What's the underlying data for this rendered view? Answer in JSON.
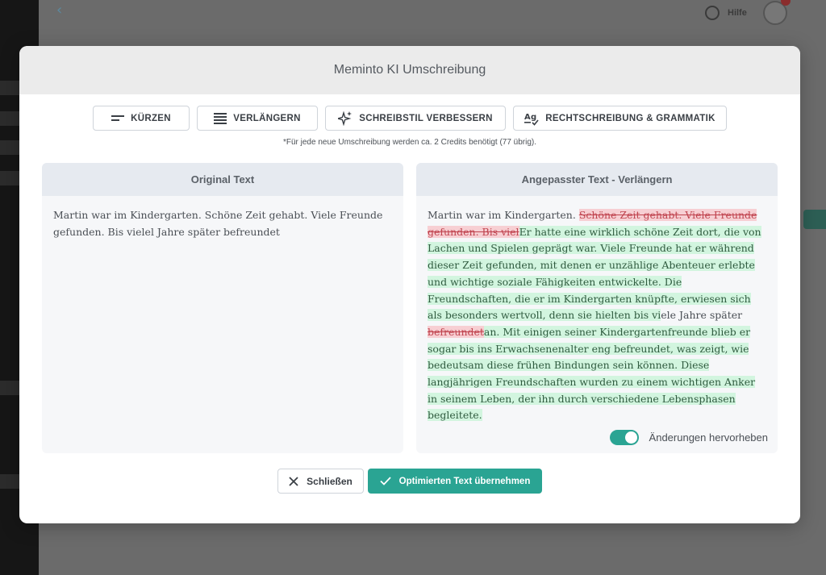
{
  "background": {
    "top_right_help": "Hilfe"
  },
  "modal": {
    "title": "Meminto KI Umschreibung",
    "toolbar": [
      {
        "label": "KÜRZEN",
        "icon": "shorten-lines-icon"
      },
      {
        "label": "VERLÄNGERN",
        "icon": "extend-lines-icon"
      },
      {
        "label": "SCHREIBSTIL VERBESSERN",
        "icon": "sparkle-icon"
      },
      {
        "label": "RECHTSCHREIBUNG & GRAMMATIK",
        "icon": "spellcheck-icon"
      }
    ],
    "credits_note": "*Für jede neue Umschreibung werden ca. 2 Credits benötigt (77 übrig).",
    "original": {
      "header": "Original Text",
      "text": "Martin war im Kindergarten. Schöne Zeit gehabt. Viele Freunde gefunden. Bis vielel Jahre später befreundet"
    },
    "adjusted": {
      "header": "Angepasster Text - Verlängern",
      "segments": [
        {
          "t": "Martin war im Kindergarten. ",
          "k": "same"
        },
        {
          "t": "Schöne Zeit gehabt. Viele Freunde gefunden. Bis viel",
          "k": "del"
        },
        {
          "t": "Er hatte eine wirklich schöne Zeit dort, die von Lachen und Spielen geprägt war. Viele Freunde hat er während dieser Zeit gefunden, mit denen er unzählige Abenteuer erlebte und wichtige soziale Fähigkeiten entwickelte. Die Freundschaften, die er im Kindergarten knüpfte, erwiesen sich als besonders wertvoll, denn sie hielten bis vi",
          "k": "ins"
        },
        {
          "t": "ele Jahre später ",
          "k": "same"
        },
        {
          "t": "befreundet",
          "k": "del"
        },
        {
          "t": "an. Mit einigen seiner Kindergartenfreunde blieb er sogar bis ins Erwachsenenalter eng befreundet, was zeigt, wie bedeutsam diese frühen Bindungen sein können. Diese langjährigen Freundschaften wurden zu einem wichtigen Anker in seinem Leben, der ihn durch verschiedene Lebensphasen begleitete.",
          "k": "ins"
        }
      ]
    },
    "highlight_toggle": {
      "label": "Änderungen hervorheben",
      "on": true
    },
    "buttons": {
      "close": "Schließen",
      "accept": "Optimierten Text übernehmen"
    },
    "colors": {
      "accent": "#2aa493",
      "deleted_bg": "#f7cfd3",
      "deleted_text": "#c0444f",
      "inserted_bg": "#d2f5df"
    }
  }
}
